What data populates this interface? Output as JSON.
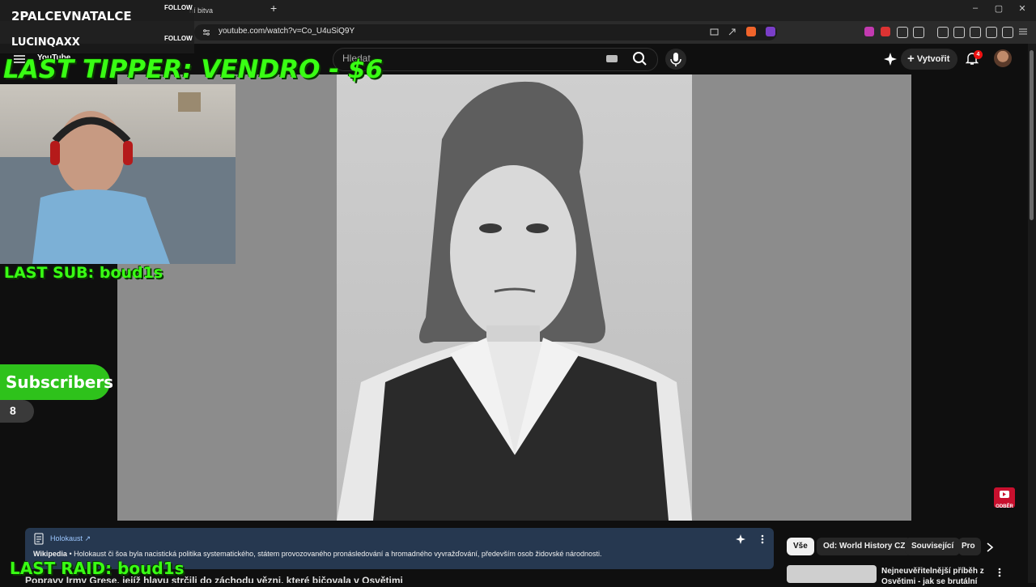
{
  "browser": {
    "tab_title": "ní bitva",
    "new_tab": "+",
    "url": "youtube.com/watch?v=Co_U4uSiQ9Y",
    "window_controls": [
      "–",
      "▢",
      "✕"
    ]
  },
  "youtube": {
    "logo_text": "YouTube",
    "search_placeholder": "Hledat",
    "create_label": "Vytvořit",
    "notification_count": "4",
    "subscribe_badge": "ODBĚR"
  },
  "overlay": {
    "channels": [
      {
        "name": "2PALCEVNATALCE",
        "follow": "FOLLOW"
      },
      {
        "name": "LUCINQAXX",
        "follow": "FOLLOW"
      }
    ],
    "last_tipper": "LAST TIPPER: VENDRO - $6",
    "last_sub": "LAST SUB: boud1s",
    "subscribers_label": "Subscribers",
    "subscribers_count": "8",
    "last_raid": "LAST RAID: boud1s"
  },
  "info_panel": {
    "link": "Holokaust ↗",
    "source": "Wikipedia",
    "text": " • Holokaust či šoa byla nacistická politika systematického, státem provozovaného pronásledování a hromadného vyvražďování, především osob židovské národnosti."
  },
  "video_title": "Popravy Irmy Grese, jejíž hlavu strčili do záchodu vězni, které bičovala v Osvětimi",
  "chips": [
    "Vše",
    "Od: World History CZ",
    "Související",
    "Pro"
  ],
  "recommendation": {
    "title": "Nejneuvěřitelnější příběh z Osvětimi - jak se brutální"
  }
}
